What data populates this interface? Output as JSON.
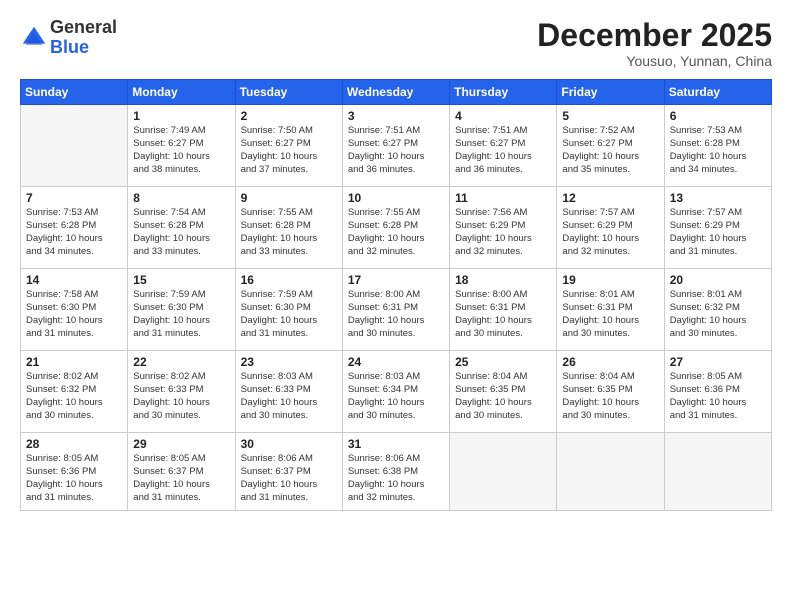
{
  "logo": {
    "general": "General",
    "blue": "Blue"
  },
  "title": {
    "month": "December 2025",
    "location": "Yousuo, Yunnan, China"
  },
  "weekdays": [
    "Sunday",
    "Monday",
    "Tuesday",
    "Wednesday",
    "Thursday",
    "Friday",
    "Saturday"
  ],
  "weeks": [
    [
      {
        "day": "",
        "empty": true
      },
      {
        "day": "1",
        "sunrise": "Sunrise: 7:49 AM",
        "sunset": "Sunset: 6:27 PM",
        "daylight": "Daylight: 10 hours and 38 minutes."
      },
      {
        "day": "2",
        "sunrise": "Sunrise: 7:50 AM",
        "sunset": "Sunset: 6:27 PM",
        "daylight": "Daylight: 10 hours and 37 minutes."
      },
      {
        "day": "3",
        "sunrise": "Sunrise: 7:51 AM",
        "sunset": "Sunset: 6:27 PM",
        "daylight": "Daylight: 10 hours and 36 minutes."
      },
      {
        "day": "4",
        "sunrise": "Sunrise: 7:51 AM",
        "sunset": "Sunset: 6:27 PM",
        "daylight": "Daylight: 10 hours and 36 minutes."
      },
      {
        "day": "5",
        "sunrise": "Sunrise: 7:52 AM",
        "sunset": "Sunset: 6:27 PM",
        "daylight": "Daylight: 10 hours and 35 minutes."
      },
      {
        "day": "6",
        "sunrise": "Sunrise: 7:53 AM",
        "sunset": "Sunset: 6:28 PM",
        "daylight": "Daylight: 10 hours and 34 minutes."
      }
    ],
    [
      {
        "day": "7",
        "sunrise": "Sunrise: 7:53 AM",
        "sunset": "Sunset: 6:28 PM",
        "daylight": "Daylight: 10 hours and 34 minutes."
      },
      {
        "day": "8",
        "sunrise": "Sunrise: 7:54 AM",
        "sunset": "Sunset: 6:28 PM",
        "daylight": "Daylight: 10 hours and 33 minutes."
      },
      {
        "day": "9",
        "sunrise": "Sunrise: 7:55 AM",
        "sunset": "Sunset: 6:28 PM",
        "daylight": "Daylight: 10 hours and 33 minutes."
      },
      {
        "day": "10",
        "sunrise": "Sunrise: 7:55 AM",
        "sunset": "Sunset: 6:28 PM",
        "daylight": "Daylight: 10 hours and 32 minutes."
      },
      {
        "day": "11",
        "sunrise": "Sunrise: 7:56 AM",
        "sunset": "Sunset: 6:29 PM",
        "daylight": "Daylight: 10 hours and 32 minutes."
      },
      {
        "day": "12",
        "sunrise": "Sunrise: 7:57 AM",
        "sunset": "Sunset: 6:29 PM",
        "daylight": "Daylight: 10 hours and 32 minutes."
      },
      {
        "day": "13",
        "sunrise": "Sunrise: 7:57 AM",
        "sunset": "Sunset: 6:29 PM",
        "daylight": "Daylight: 10 hours and 31 minutes."
      }
    ],
    [
      {
        "day": "14",
        "sunrise": "Sunrise: 7:58 AM",
        "sunset": "Sunset: 6:30 PM",
        "daylight": "Daylight: 10 hours and 31 minutes."
      },
      {
        "day": "15",
        "sunrise": "Sunrise: 7:59 AM",
        "sunset": "Sunset: 6:30 PM",
        "daylight": "Daylight: 10 hours and 31 minutes."
      },
      {
        "day": "16",
        "sunrise": "Sunrise: 7:59 AM",
        "sunset": "Sunset: 6:30 PM",
        "daylight": "Daylight: 10 hours and 31 minutes."
      },
      {
        "day": "17",
        "sunrise": "Sunrise: 8:00 AM",
        "sunset": "Sunset: 6:31 PM",
        "daylight": "Daylight: 10 hours and 30 minutes."
      },
      {
        "day": "18",
        "sunrise": "Sunrise: 8:00 AM",
        "sunset": "Sunset: 6:31 PM",
        "daylight": "Daylight: 10 hours and 30 minutes."
      },
      {
        "day": "19",
        "sunrise": "Sunrise: 8:01 AM",
        "sunset": "Sunset: 6:31 PM",
        "daylight": "Daylight: 10 hours and 30 minutes."
      },
      {
        "day": "20",
        "sunrise": "Sunrise: 8:01 AM",
        "sunset": "Sunset: 6:32 PM",
        "daylight": "Daylight: 10 hours and 30 minutes."
      }
    ],
    [
      {
        "day": "21",
        "sunrise": "Sunrise: 8:02 AM",
        "sunset": "Sunset: 6:32 PM",
        "daylight": "Daylight: 10 hours and 30 minutes."
      },
      {
        "day": "22",
        "sunrise": "Sunrise: 8:02 AM",
        "sunset": "Sunset: 6:33 PM",
        "daylight": "Daylight: 10 hours and 30 minutes."
      },
      {
        "day": "23",
        "sunrise": "Sunrise: 8:03 AM",
        "sunset": "Sunset: 6:33 PM",
        "daylight": "Daylight: 10 hours and 30 minutes."
      },
      {
        "day": "24",
        "sunrise": "Sunrise: 8:03 AM",
        "sunset": "Sunset: 6:34 PM",
        "daylight": "Daylight: 10 hours and 30 minutes."
      },
      {
        "day": "25",
        "sunrise": "Sunrise: 8:04 AM",
        "sunset": "Sunset: 6:35 PM",
        "daylight": "Daylight: 10 hours and 30 minutes."
      },
      {
        "day": "26",
        "sunrise": "Sunrise: 8:04 AM",
        "sunset": "Sunset: 6:35 PM",
        "daylight": "Daylight: 10 hours and 30 minutes."
      },
      {
        "day": "27",
        "sunrise": "Sunrise: 8:05 AM",
        "sunset": "Sunset: 6:36 PM",
        "daylight": "Daylight: 10 hours and 31 minutes."
      }
    ],
    [
      {
        "day": "28",
        "sunrise": "Sunrise: 8:05 AM",
        "sunset": "Sunset: 6:36 PM",
        "daylight": "Daylight: 10 hours and 31 minutes."
      },
      {
        "day": "29",
        "sunrise": "Sunrise: 8:05 AM",
        "sunset": "Sunset: 6:37 PM",
        "daylight": "Daylight: 10 hours and 31 minutes."
      },
      {
        "day": "30",
        "sunrise": "Sunrise: 8:06 AM",
        "sunset": "Sunset: 6:37 PM",
        "daylight": "Daylight: 10 hours and 31 minutes."
      },
      {
        "day": "31",
        "sunrise": "Sunrise: 8:06 AM",
        "sunset": "Sunset: 6:38 PM",
        "daylight": "Daylight: 10 hours and 32 minutes."
      },
      {
        "day": "",
        "empty": true
      },
      {
        "day": "",
        "empty": true
      },
      {
        "day": "",
        "empty": true
      }
    ]
  ]
}
